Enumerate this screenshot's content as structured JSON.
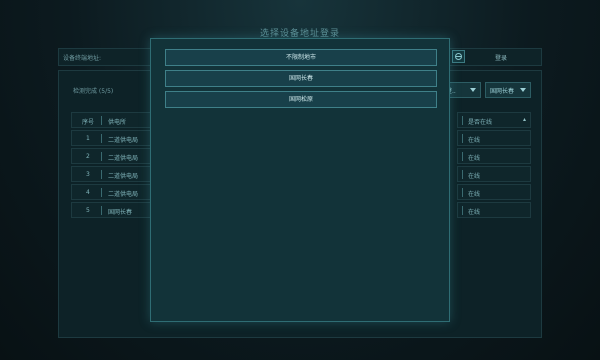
{
  "title": "选择设备地址登录",
  "address_bar": {
    "label": "设备终端地址:",
    "login_label": "登录"
  },
  "main": {
    "scan_status": "检测完成 (5/5)",
    "selects": [
      {
        "label": "已登..",
        "icon": "chevron-down-icon"
      },
      {
        "label": "国网长春",
        "icon": "chevron-down-icon"
      }
    ],
    "table": {
      "headers": {
        "no": "序号",
        "name": "供电所",
        "status": "是否在线"
      },
      "rows": [
        {
          "no": "1",
          "name": "二道供电局",
          "status": "在线"
        },
        {
          "no": "2",
          "name": "二道供电局",
          "status": "在线"
        },
        {
          "no": "3",
          "name": "二道供电局",
          "status": "在线"
        },
        {
          "no": "4",
          "name": "二道供电局",
          "status": "在线"
        },
        {
          "no": "5",
          "name": "国网长春",
          "status": "在线"
        }
      ]
    }
  },
  "modal": {
    "options": [
      "不限制地市",
      "国网长春",
      "国网松原"
    ]
  },
  "colors": {
    "background": "#0c1a1f",
    "modal_bg": "#123339",
    "accent": "#3f8089",
    "text": "#7fb3b9"
  }
}
